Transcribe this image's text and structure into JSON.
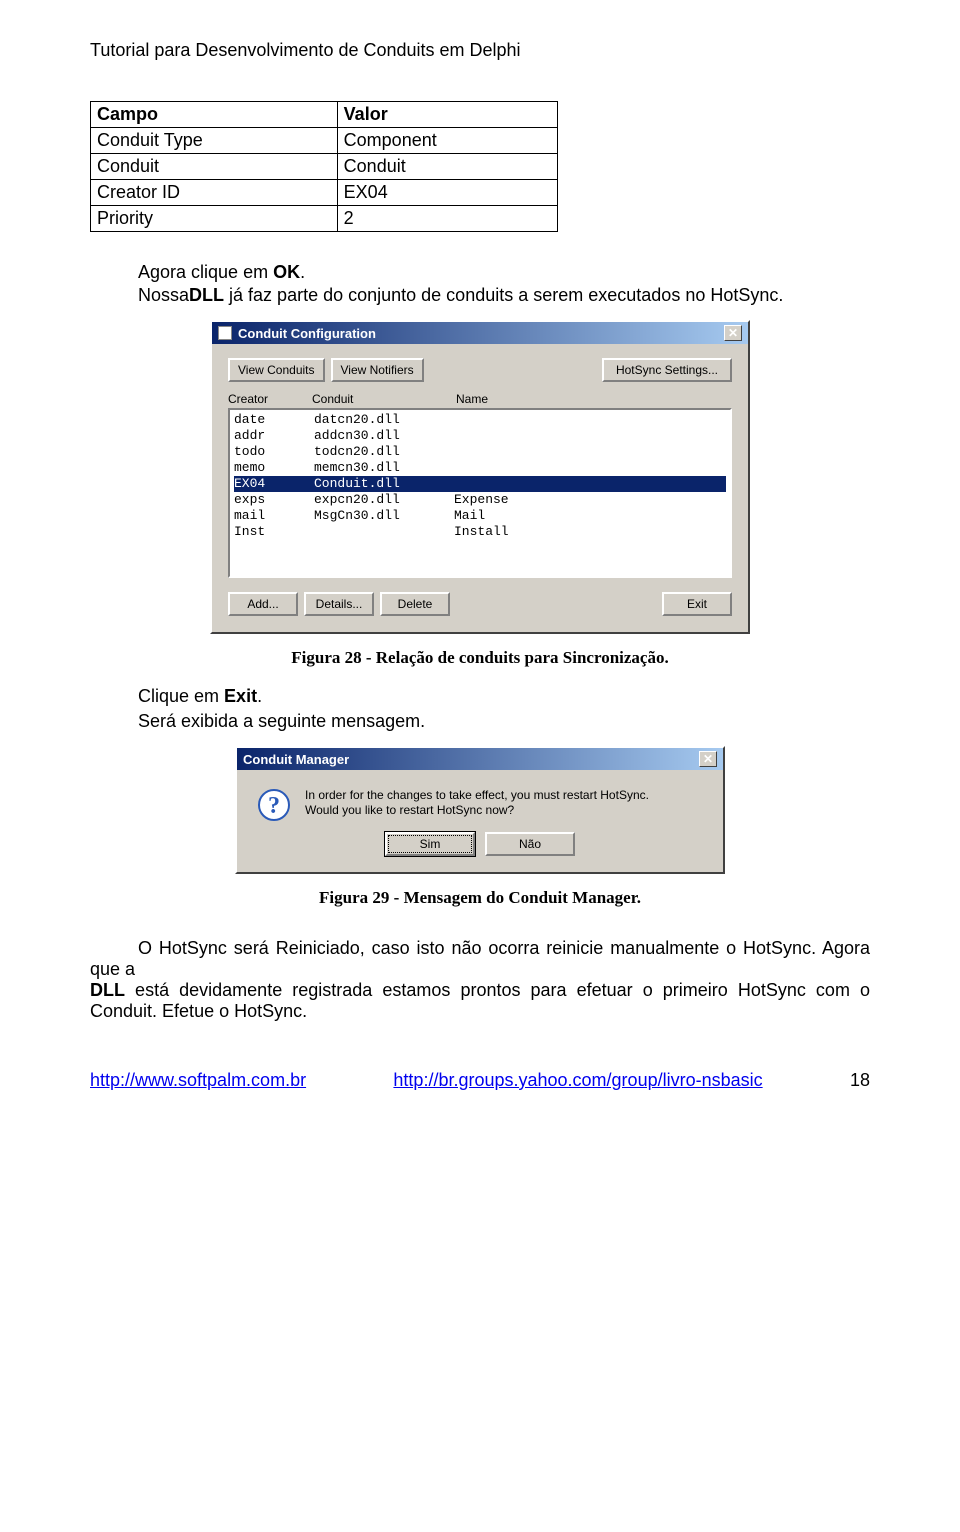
{
  "doc": {
    "header": "Tutorial para Desenvolvimento de Conduits em Delphi",
    "page_number": "18"
  },
  "table": {
    "head_field": "Campo",
    "head_value": "Valor",
    "rows": [
      {
        "field": "Conduit Type",
        "value": "Component"
      },
      {
        "field": "Conduit",
        "value": "Conduit"
      },
      {
        "field": "Creator ID",
        "value": "EX04"
      },
      {
        "field": "Priority",
        "value": "2"
      }
    ]
  },
  "para1_before_bold": "Agora clique em ",
  "para1_bold": "OK",
  "para1_after_bold": ".",
  "para2_before_bold": "Nossa ",
  "para2_bold": "DLL",
  "para2_after_bold": " já faz parte do conjunto de conduits a serem executados no HotSync.",
  "dialog1": {
    "title": "Conduit Configuration",
    "btn_view_conduits": "View Conduits",
    "btn_view_notifiers": "View Notifiers",
    "btn_hotsync_settings": "HotSync Settings...",
    "col_creator": "Creator",
    "col_conduit": "Conduit",
    "col_name": "Name",
    "rows": [
      {
        "creator": "date",
        "conduit": "datcn20.dll",
        "name": ""
      },
      {
        "creator": "addr",
        "conduit": "addcn30.dll",
        "name": ""
      },
      {
        "creator": "todo",
        "conduit": "todcn20.dll",
        "name": ""
      },
      {
        "creator": "memo",
        "conduit": "memcn30.dll",
        "name": ""
      },
      {
        "creator": "EX04",
        "conduit": "Conduit.dll",
        "name": "",
        "selected": true
      },
      {
        "creator": "exps",
        "conduit": "expcn20.dll",
        "name": "Expense"
      },
      {
        "creator": "mail",
        "conduit": "MsgCn30.dll",
        "name": "Mail"
      },
      {
        "creator": "Inst",
        "conduit": "",
        "name": "Install"
      }
    ],
    "btn_add": "Add...",
    "btn_details": "Details...",
    "btn_delete": "Delete",
    "btn_exit": "Exit"
  },
  "caption1": "Figura 28 - Relação de conduits para Sincronização.",
  "para3_before_bold": "Clique em ",
  "para3_bold": "Exit",
  "para3_after_bold": ".",
  "para4": "Será exibida a seguinte mensagem.",
  "dialog2": {
    "title": "Conduit Manager",
    "line1": "In order for the changes to take effect, you must restart HotSync.",
    "line2": "Would you like to restart HotSync now?",
    "btn_yes": "Sim",
    "btn_no": "Não"
  },
  "caption2": "Figura 29 - Mensagem do Conduit Manager.",
  "para5_a": "O HotSync será Reiniciado, caso isto não ocorra reinicie manualmente o HotSync. Agora que a ",
  "para5_bold": "DLL",
  "para5_b": " está devidamente registrada estamos prontos para efetuar o primeiro HotSync com o Conduit. Efetue o HotSync.",
  "footer": {
    "link1": "http://www.softpalm.com.br",
    "link2": "http://br.groups.yahoo.com/group/livro-nsbasic"
  }
}
